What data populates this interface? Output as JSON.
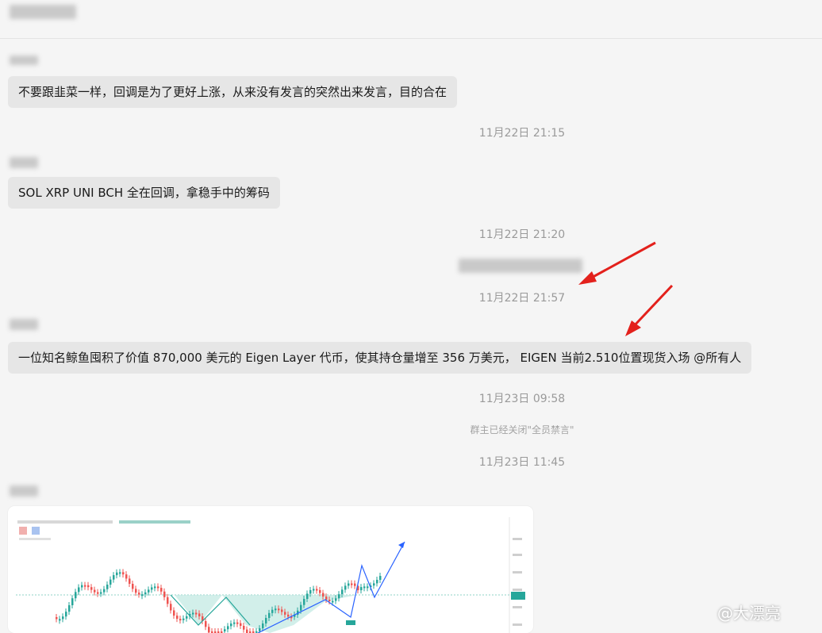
{
  "messages": [
    {
      "text": "不要跟韭菜一样，回调是为了更好上涨，从来没有发言的突然出来发言，目的合在"
    },
    {
      "text": "SOL XRP UNI BCH 全在回调，拿稳手中的筹码"
    },
    {
      "text": "一位知名鲸鱼囤积了价值 870,000 美元的 Eigen Layer 代币，使其持仓量增至 356 万美元， EIGEN 当前2.510位置现货入场 @所有人"
    }
  ],
  "timestamps": [
    "11月22日 21:15",
    "11月22日 21:20",
    "11月22日 21:57",
    "11月23日 09:58",
    "11月23日 11:45"
  ],
  "system_notice": "群主已经关闭\"全员禁言\"",
  "watermark": "@大漂亮",
  "colors": {
    "arrow": "#e3211c",
    "bubble": "#e6e6e6",
    "chart_up": "#26a69a",
    "chart_down": "#ef5350"
  }
}
